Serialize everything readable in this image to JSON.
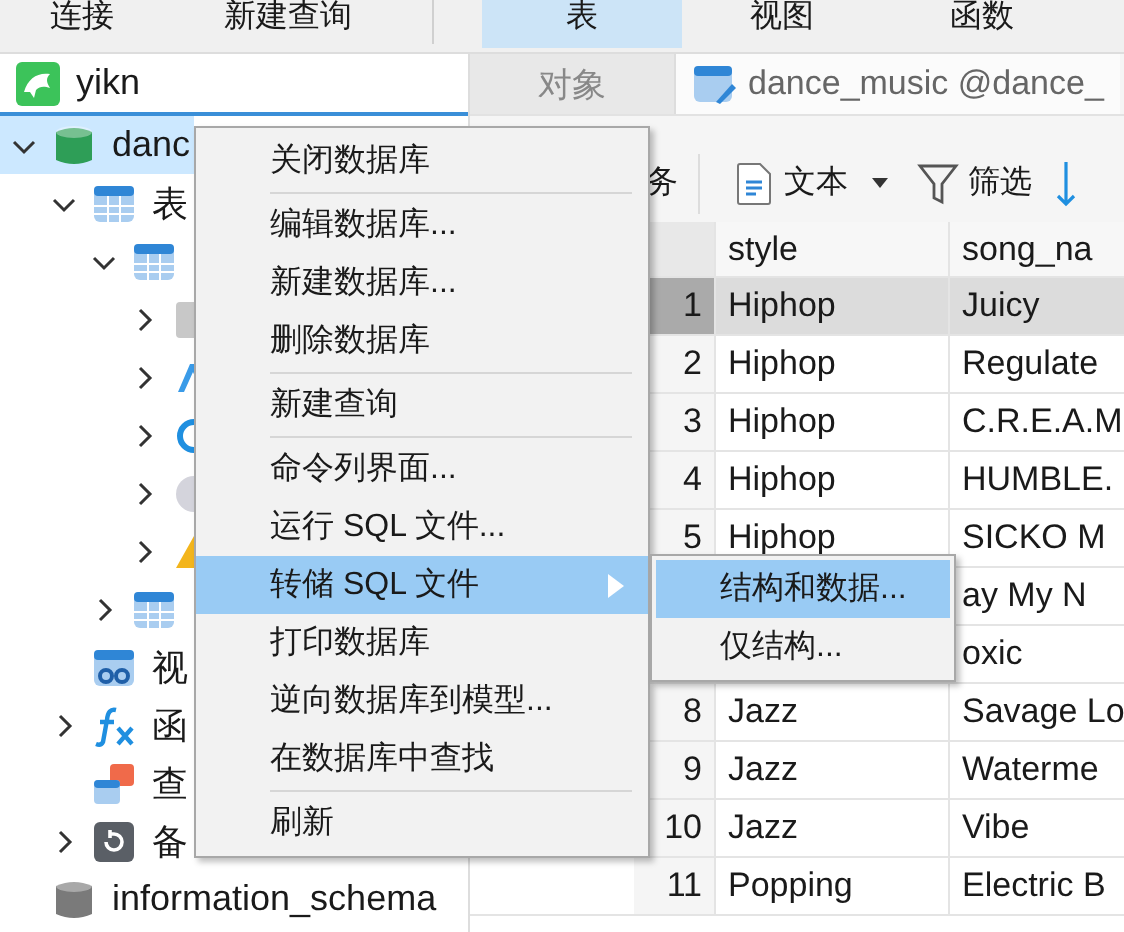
{
  "toolbar": {
    "buttons": [
      {
        "label": "连接"
      },
      {
        "label": "新建查询"
      }
    ]
  },
  "object_tabs": [
    {
      "label": "表",
      "selected": true
    },
    {
      "label": "视图",
      "selected": false
    },
    {
      "label": "函数",
      "selected": false
    }
  ],
  "sidebar": {
    "connection": {
      "label": "yikn"
    },
    "tree": [
      {
        "label": "danc",
        "kind": "database",
        "color": "#2e9e57",
        "expanded": true,
        "selected": true,
        "children": [
          {
            "label": "表",
            "kind": "tables",
            "expanded": true,
            "selected": false,
            "children": [
              {
                "kind": "table",
                "expanded": true,
                "selected": false,
                "children": [
                  {
                    "kind": "block",
                    "expanded": false,
                    "selected": false
                  },
                  {
                    "kind": "letter",
                    "expanded": false,
                    "selected": false
                  },
                  {
                    "kind": "loop",
                    "expanded": false,
                    "selected": false
                  },
                  {
                    "kind": "disc",
                    "expanded": false,
                    "selected": false
                  },
                  {
                    "kind": "warning",
                    "expanded": false,
                    "selected": false
                  }
                ]
              },
              {
                "kind": "table",
                "expanded": false,
                "selected": false
              }
            ]
          },
          {
            "label": "视",
            "kind": "view",
            "selected": false
          },
          {
            "label": "函",
            "kind": "function",
            "expanded": false,
            "selected": false
          },
          {
            "label": "查",
            "kind": "query",
            "selected": false
          },
          {
            "label": "备",
            "kind": "backup",
            "expanded": false,
            "selected": false
          }
        ]
      },
      {
        "label": "information_schema",
        "kind": "database",
        "color": "#7a7a7a",
        "selected": false
      }
    ]
  },
  "tabs": [
    {
      "label": "对象",
      "kind": "plain",
      "selected": false
    },
    {
      "label": "dance_music @dance_",
      "kind": "table",
      "selected": true
    }
  ],
  "table_toolbar": {
    "items": [
      {
        "kind": "text",
        "label": "务"
      },
      {
        "kind": "format",
        "label": "文本"
      },
      {
        "kind": "filter",
        "label": "筛选"
      },
      {
        "kind": "sort"
      }
    ]
  },
  "table": {
    "columns": [
      "style",
      "song_na"
    ],
    "rows": [
      {
        "number": "1",
        "selected": true,
        "cells": [
          "Hiphop",
          "Juicy"
        ]
      },
      {
        "number": "2",
        "selected": false,
        "cells": [
          "Hiphop",
          "Regulate"
        ]
      },
      {
        "number": "3",
        "selected": false,
        "cells": [
          "Hiphop",
          "C.R.E.A.M"
        ]
      },
      {
        "number": "4",
        "selected": false,
        "cells": [
          "Hiphop",
          "HUMBLE."
        ]
      },
      {
        "number": "5",
        "selected": false,
        "cells": [
          "Hiphop",
          "SICKO M"
        ]
      },
      {
        "selected": false,
        "cells": [
          null,
          "ay My N"
        ]
      },
      {
        "selected": false,
        "cells": [
          null,
          "oxic"
        ]
      },
      {
        "number": "8",
        "selected": false,
        "cells": [
          "Jazz",
          "Savage Lo"
        ]
      },
      {
        "number": "9",
        "selected": false,
        "cells": [
          "Jazz",
          "Waterme"
        ]
      },
      {
        "number": "10",
        "selected": false,
        "cells": [
          "Jazz",
          "Vibe"
        ]
      },
      {
        "number": "11",
        "selected": false,
        "cells": [
          "Popping",
          "Electric B"
        ]
      }
    ]
  },
  "context_menu": {
    "groups": [
      [
        {
          "label": "关闭数据库",
          "selected": false,
          "has_submenu": false
        }
      ],
      [
        {
          "label": "编辑数据库...",
          "selected": false,
          "has_submenu": false
        },
        {
          "label": "新建数据库...",
          "selected": false,
          "has_submenu": false
        },
        {
          "label": "删除数据库",
          "selected": false,
          "has_submenu": false
        }
      ],
      [
        {
          "label": "新建查询",
          "selected": false,
          "has_submenu": false
        }
      ],
      [
        {
          "label": "命令列界面...",
          "selected": false,
          "has_submenu": false
        },
        {
          "label": "运行 SQL 文件...",
          "selected": false,
          "has_submenu": false
        },
        {
          "label": "转储 SQL 文件",
          "selected": true,
          "has_submenu": true
        },
        {
          "label": "打印数据库",
          "selected": false,
          "has_submenu": false
        },
        {
          "label": "逆向数据库到模型...",
          "selected": false,
          "has_submenu": false
        },
        {
          "label": "在数据库中查找",
          "selected": false,
          "has_submenu": false
        }
      ],
      [
        {
          "label": "刷新",
          "selected": false,
          "has_submenu": false
        }
      ]
    ]
  },
  "submenu": {
    "items": [
      {
        "label": "结构和数据...",
        "selected": true
      },
      {
        "label": "仅结构...",
        "selected": false
      }
    ]
  }
}
